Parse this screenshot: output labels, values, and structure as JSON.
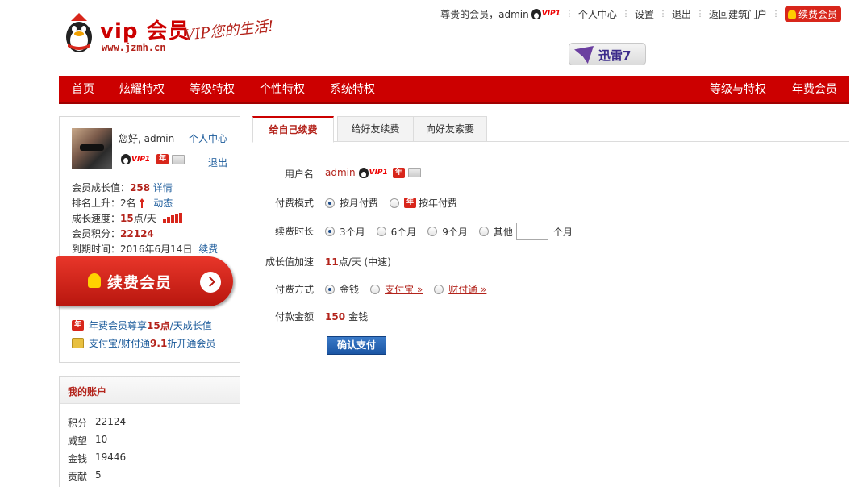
{
  "logo": {
    "title": "vip 会员",
    "slogan": "VIP您的生活!",
    "url": "www.jzmh.cn"
  },
  "topbar": {
    "greeting": "尊贵的会员，admin",
    "vip_level": "VIP1",
    "personal_center": "个人中心",
    "settings": "设置",
    "logout": "退出",
    "back_portal": "返回建筑门户",
    "renew": "续费会员"
  },
  "xunlei": {
    "label": "迅雷7"
  },
  "nav": {
    "left": [
      "首页",
      "炫耀特权",
      "等级特权",
      "个性特权",
      "系统特权"
    ],
    "right": [
      "等级与特权",
      "年费会员"
    ]
  },
  "profile": {
    "hello": "您好, admin",
    "personal_center": "个人中心",
    "vip_level": "VIP1",
    "year_badge": "年",
    "logout": "退出",
    "growth_label": "会员成长值：",
    "growth_value": "258",
    "growth_link": "详情",
    "rank_label": "排名上升：2名",
    "rank_link": "动态",
    "speed_label": "成长速度：",
    "speed_value": "15",
    "speed_unit": "点/天",
    "points_label": "会员积分：",
    "points_value": "22124",
    "expire_label": "到期时间：2016年6月14日",
    "expire_link": "续费",
    "renew_button": "续费会员",
    "promo1_a": "年费会员尊享",
    "promo1_b": "15点",
    "promo1_c": "/天成长值",
    "promo2_a": "支付宝/财付通",
    "promo2_b": "9.1",
    "promo2_c": "折开通会员"
  },
  "account": {
    "title": "我的账户",
    "rows": [
      {
        "label": "积分",
        "value": "22124"
      },
      {
        "label": "威望",
        "value": "10"
      },
      {
        "label": "金钱",
        "value": "19446"
      },
      {
        "label": "贡献",
        "value": "5"
      }
    ]
  },
  "tabs": [
    "给自己续费",
    "给好友续费",
    "向好友索要"
  ],
  "form": {
    "username_label": "用户名",
    "username": "admin",
    "pay_mode_label": "付费模式",
    "pay_mode_monthly": "按月付费",
    "pay_mode_yearly": "按年付费",
    "duration_label": "续费时长",
    "duration_options": [
      "3个月",
      "6个月",
      "9个月",
      "其他"
    ],
    "duration_unit": "个月",
    "other_months_value": "",
    "growth_label": "成长值加速",
    "growth_value": "11",
    "growth_unit": "点/天 (中速)",
    "pay_method_label": "付费方式",
    "pay_method_money": "金钱",
    "pay_method_alipay": "支付宝 »",
    "pay_method_tenpay": "财付通 »",
    "amount_label": "付款金额",
    "amount_value": "150",
    "amount_unit": "金钱",
    "confirm": "确认支付"
  }
}
